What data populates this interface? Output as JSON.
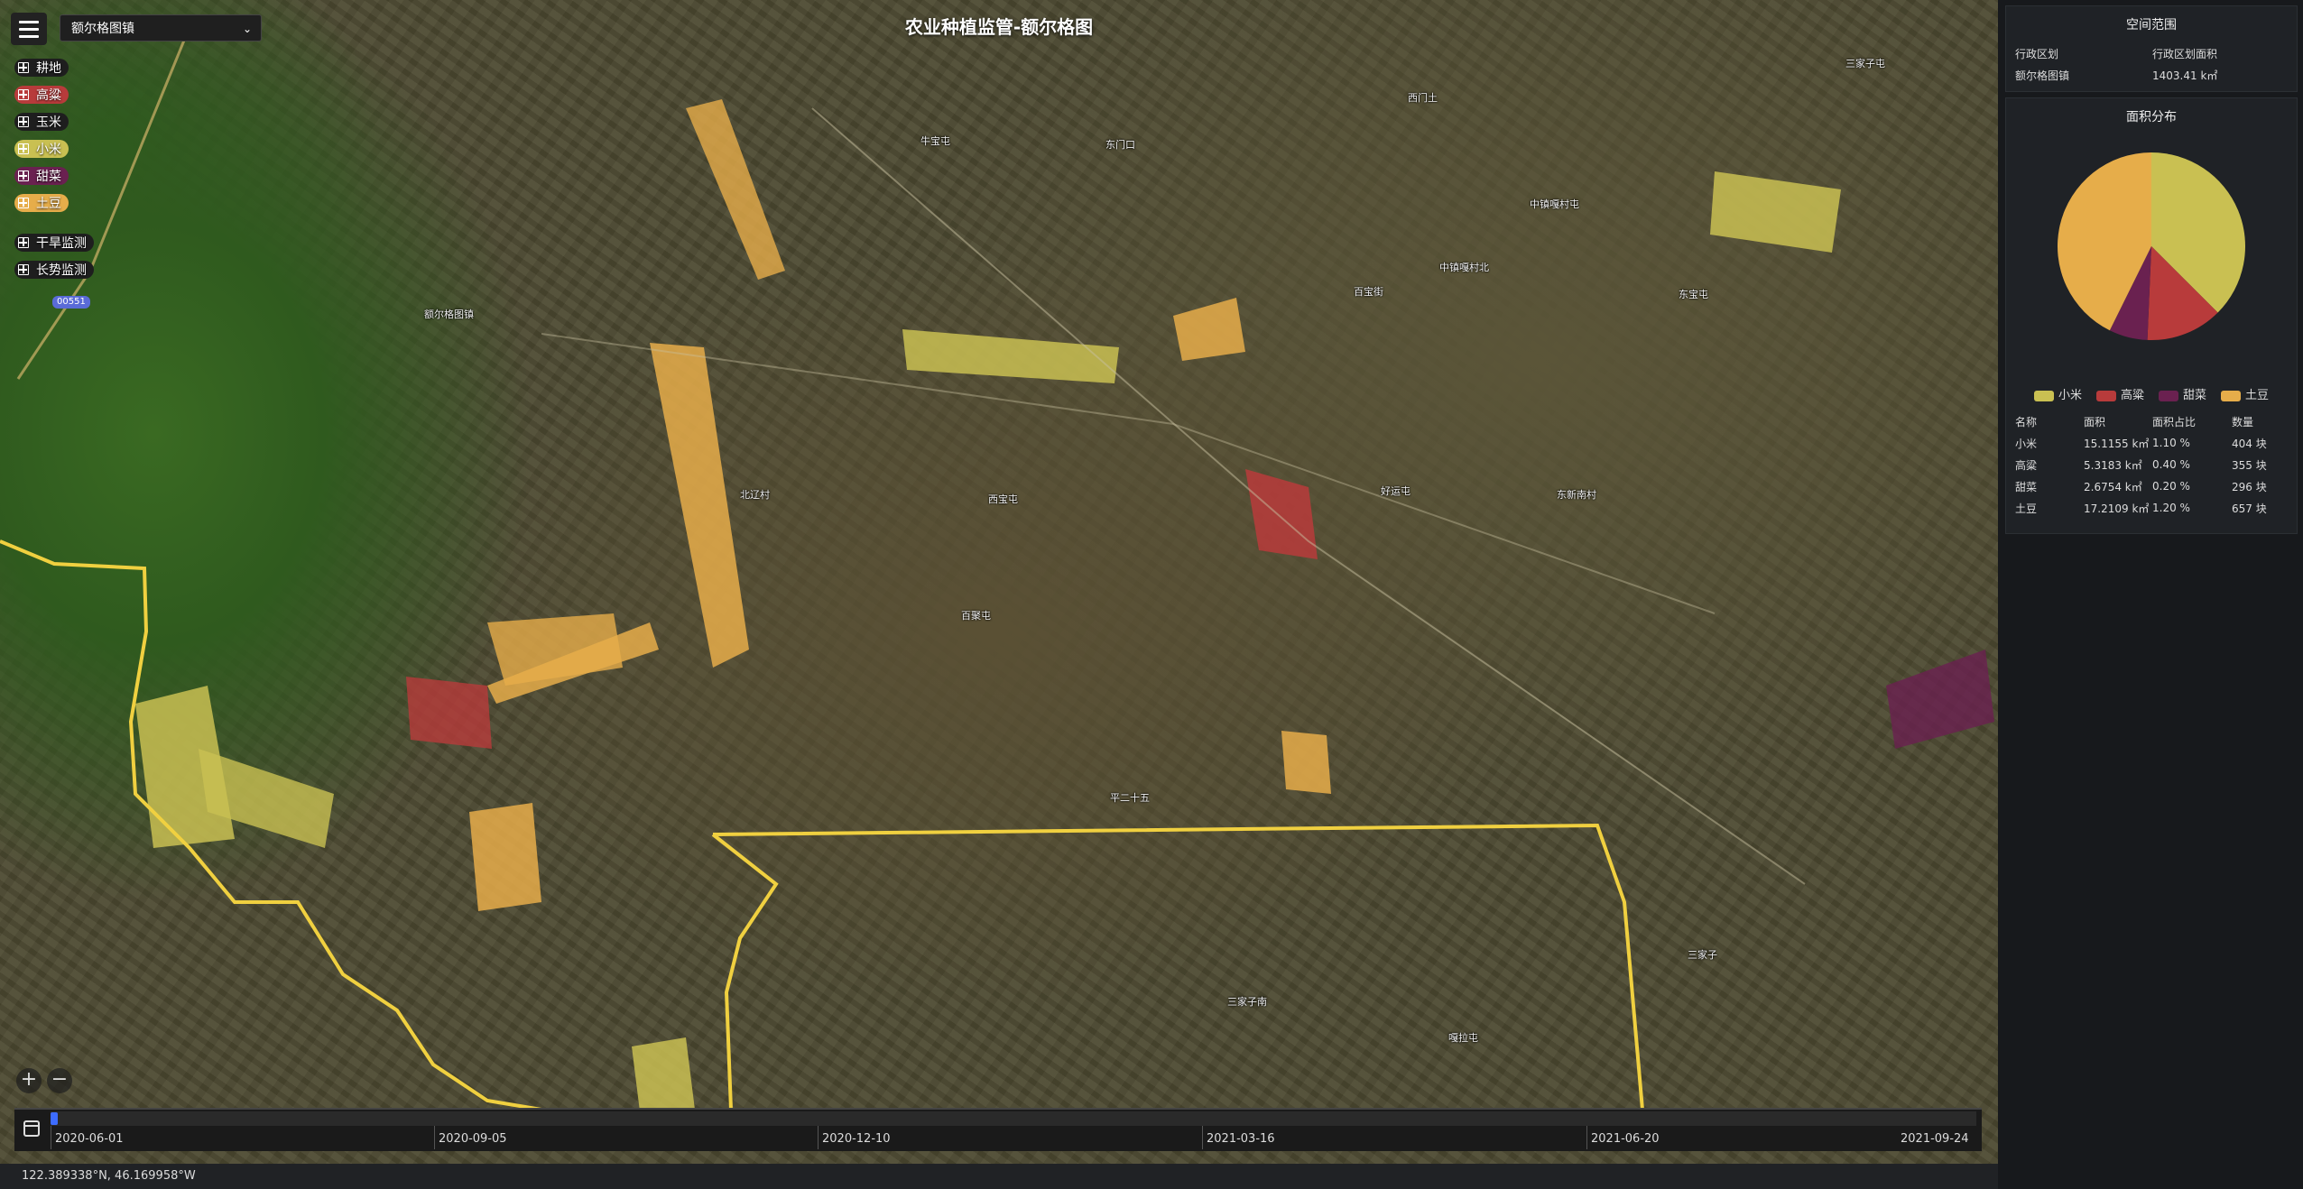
{
  "map": {
    "title": "农业种植监管-额尔格图",
    "region_select": "额尔格图镇",
    "coords": "122.389338°N, 46.169958°W",
    "place_labels": [
      "额尔格图镇",
      "西门土",
      "牛宝屯",
      "东门口",
      "中镇嘎村屯",
      "中镇嘎村北",
      "三家子屯",
      "百宝街",
      "东宝屯",
      "西宝屯",
      "三家子南",
      "三家子",
      "好运屯",
      "百聚屯",
      "嘎拉屯",
      "东新南村",
      "北辽村",
      "平二十五"
    ]
  },
  "layers": [
    {
      "label": "耕地",
      "color": "#1e1e1e"
    },
    {
      "label": "高粱",
      "color": "#b83b3b"
    },
    {
      "label": "玉米",
      "color": "#1e1e1e"
    },
    {
      "label": "小米",
      "color": "#c9c052"
    },
    {
      "label": "甜菜",
      "color": "#6a2150"
    },
    {
      "label": "土豆",
      "color": "#e6ad4a"
    },
    {
      "label": "干旱监测",
      "color": "#1e1e1e"
    },
    {
      "label": "长势监测",
      "color": "#1e1e1e"
    }
  ],
  "badge": "00551",
  "zoom": {
    "in": "+",
    "out": "−"
  },
  "timeline": {
    "ticks": [
      "2020-06-01",
      "2020-09-05",
      "2020-12-10",
      "2021-03-16",
      "2021-06-20",
      "2021-09-24"
    ],
    "progress": 0.0
  },
  "panel": {
    "spatial": {
      "title": "空间范围",
      "col1_header": "行政区划",
      "col2_header": "行政区划面积",
      "col1_value": "额尔格图镇",
      "col2_value": "1403.41 k㎡"
    },
    "distribution": {
      "title": "面积分布",
      "headers": [
        "名称",
        "面积",
        "面积占比",
        "数量"
      ],
      "rows": [
        [
          "小米",
          "15.1155 k㎡",
          "1.10 %",
          "404 块"
        ],
        [
          "高粱",
          "5.3183 k㎡",
          "0.40 %",
          "355 块"
        ],
        [
          "甜菜",
          "2.6754 k㎡",
          "0.20 %",
          "296 块"
        ],
        [
          "土豆",
          "17.2109 k㎡",
          "1.20 %",
          "657 块"
        ]
      ]
    }
  },
  "chart_data": {
    "type": "pie",
    "labels": [
      "小米",
      "高粱",
      "甜菜",
      "土豆"
    ],
    "values": [
      15.1155,
      5.3183,
      2.6754,
      17.2109
    ],
    "colors": [
      "#c9c052",
      "#b83b3b",
      "#6a2150",
      "#e6ad4a"
    ],
    "legend": "bottom"
  }
}
